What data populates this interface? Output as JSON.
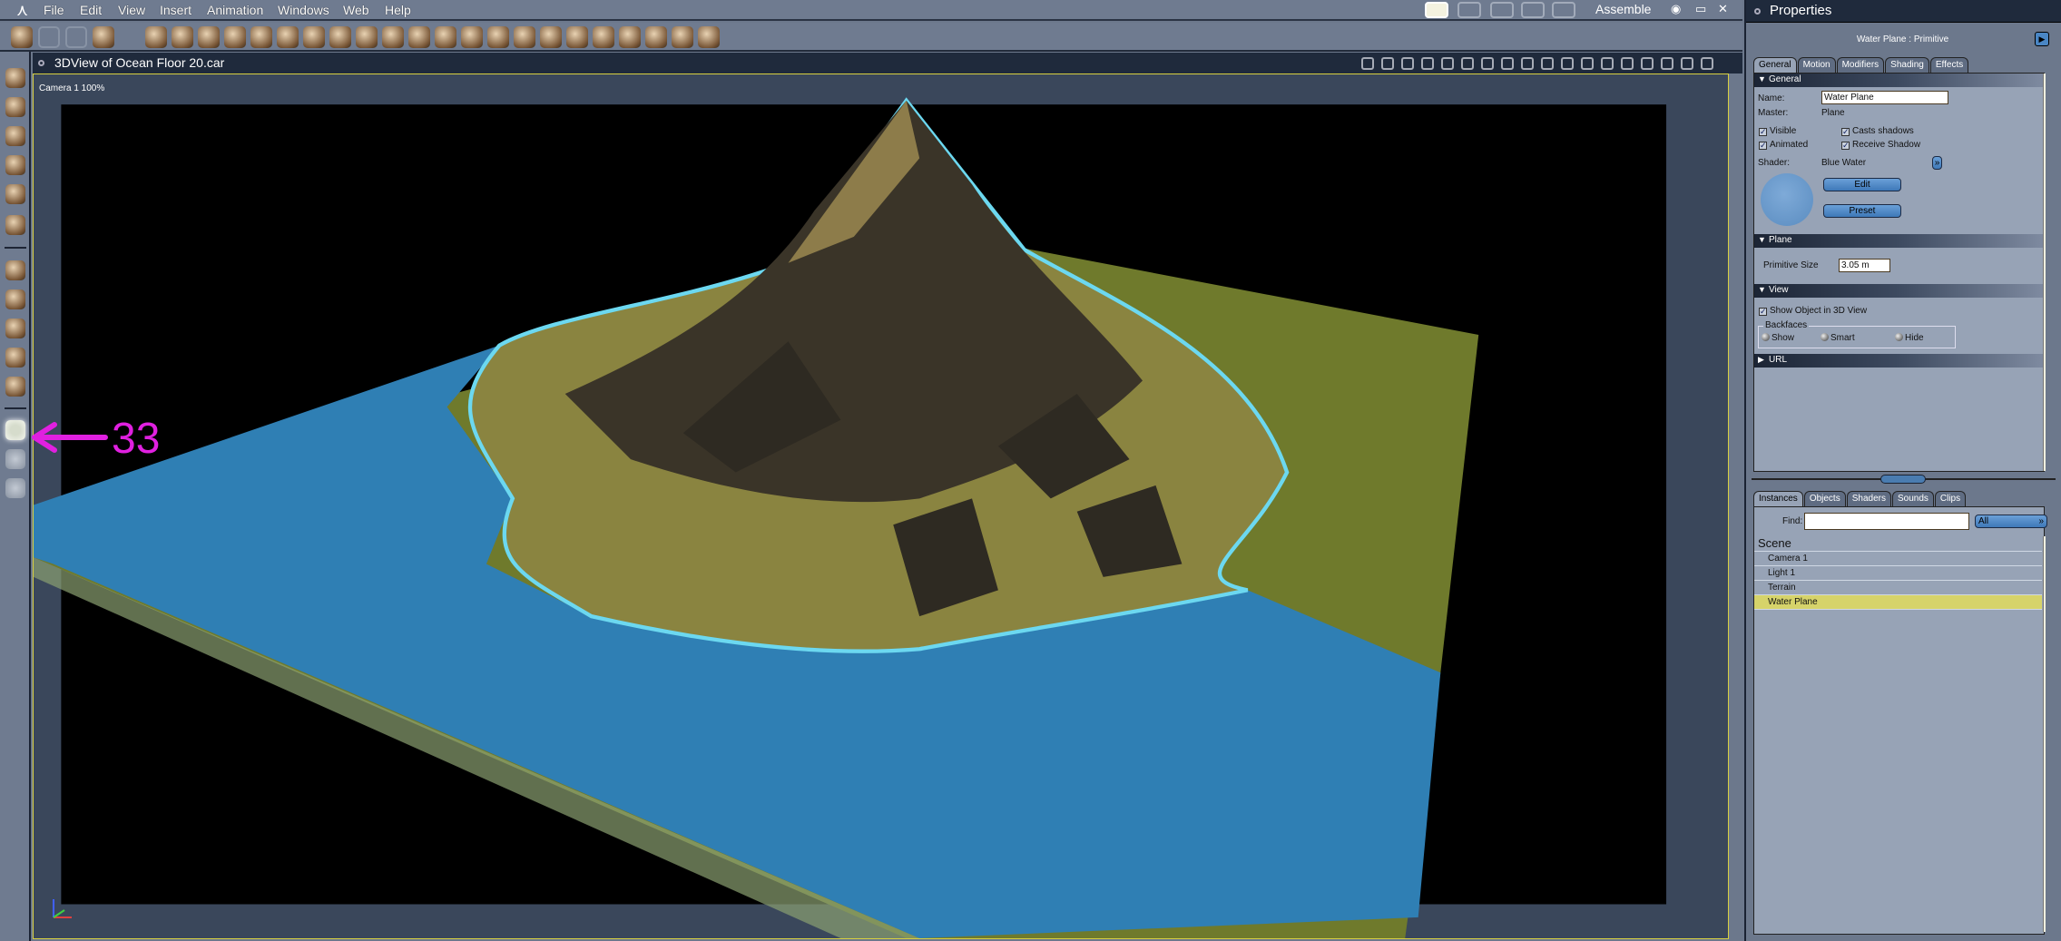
{
  "menubar": {
    "items": [
      "File",
      "Edit",
      "View",
      "Insert",
      "Animation",
      "Windows",
      "Web",
      "Help"
    ],
    "mode": "Assemble"
  },
  "toolbar": {
    "icons": [
      "object-tool-icon",
      "hand-disabled-icon",
      "wrench-disabled-icon",
      "paint-brush-icon",
      "checker-plane-icon",
      "goblet-icon",
      "sphere-icon",
      "bone-icon",
      "ring-icon",
      "text-icon",
      "particles-icon",
      "terrain-icon",
      "tree-icon",
      "cloud-icon",
      "fire-icon",
      "metablob-icon",
      "grass-icon",
      "agr-icon",
      "house-icon",
      "capsule-icon",
      "bowl-icon",
      "mushroom-icon",
      "wand-icon",
      "network-icon",
      "target-icon",
      "key-icon"
    ]
  },
  "viewport": {
    "title": "3DView of Ocean Floor 20.car",
    "camera_label": "Camera 1 100%"
  },
  "annotation": {
    "number": "33",
    "color": "#e020e0"
  },
  "properties": {
    "title": "Properties",
    "object_title": "Water Plane : Primitive",
    "tabs": [
      "General",
      "Motion",
      "Modifiers",
      "Shading",
      "Effects"
    ],
    "general": {
      "header": "General",
      "name_label": "Name:",
      "name_value": "Water Plane",
      "master_label": "Master:",
      "master_value": "Plane",
      "visible": "Visible",
      "animated": "Animated",
      "casts_shadows": "Casts shadows",
      "receive_shadow": "Receive Shadow",
      "shader_label": "Shader:",
      "shader_value": "Blue Water",
      "edit": "Edit",
      "preset": "Preset"
    },
    "plane": {
      "header": "Plane",
      "size_label": "Primitive Size",
      "size_value": "3.05 m"
    },
    "view": {
      "header": "View",
      "show_object": "Show Object in 3D View",
      "backfaces": "Backfaces",
      "show": "Show",
      "smart": "Smart",
      "hide": "Hide"
    },
    "url": {
      "header": "URL"
    }
  },
  "browser": {
    "tabs": [
      "Instances",
      "Objects",
      "Shaders",
      "Sounds",
      "Clips"
    ],
    "find_label": "Find:",
    "find_value": "",
    "filter": "All",
    "scene": "Scene",
    "items": [
      "Camera 1",
      "Light 1",
      "Terrain",
      "Water Plane"
    ]
  },
  "colors": {
    "accent": "#4a86c4",
    "selected": "#d6d36a",
    "panel": "#97a3b6"
  }
}
